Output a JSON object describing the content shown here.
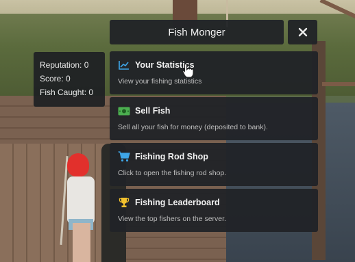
{
  "stats": {
    "reputation": "Reputation: 0",
    "score": "Score: 0",
    "fish_caught": "Fish Caught: 0"
  },
  "header": {
    "title": "Fish Monger",
    "close_icon": "close-icon"
  },
  "menu": {
    "items": [
      {
        "title": "Your Statistics",
        "description": "View your fishing statistics",
        "icon": "chart-line-icon",
        "icon_color": "#3ea6e8"
      },
      {
        "title": "Sell Fish",
        "description": "Sell all your fish for money (deposited to bank).",
        "icon": "money-icon",
        "icon_color": "#4caf50"
      },
      {
        "title": "Fishing Rod Shop",
        "description": "Click to open the fishing rod shop.",
        "icon": "shopping-cart-icon",
        "icon_color": "#3ea6e8"
      },
      {
        "title": "Fishing Leaderboard",
        "description": "View the top fishers on the server.",
        "icon": "trophy-icon",
        "icon_color": "#f2c12e"
      }
    ]
  }
}
